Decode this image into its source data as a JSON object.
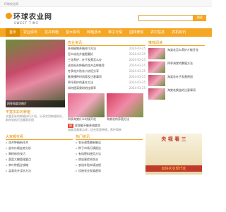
{
  "topbar": {
    "text": "环球农业网"
  },
  "logo": {
    "cn": "环球农业网",
    "en": "SWEET TIME"
  },
  "search": {
    "placeholder": "",
    "button": "搜索"
  },
  "nav": [
    "首页",
    "农业资讯",
    "花卉种植",
    "苗木资讯",
    "种植技术",
    "种子行情",
    "园林景观",
    "农村信息",
    "农机资讯"
  ],
  "hero": {
    "caption": "四季海棠花图片"
  },
  "featured": {
    "title": "丰富多彩的种植",
    "desc": "丰富多彩的种植技巧介绍，分享实用种植知识，助你轻松打造美丽花园"
  },
  "news": {
    "heading": "农业资讯",
    "items": [
      {
        "t": "多肉植物养殖技巧方法",
        "d": "2024-03-25"
      },
      {
        "t": "怎么给花卉施肥最好",
        "d": "2024-03-25"
      },
      {
        "t": "兰花养护：叶子发黄怎么办",
        "d": "2024-03-25"
      },
      {
        "t": "适合阳台种植的花卉品种推荐",
        "d": "2024-03-25"
      },
      {
        "t": "冬季花卉防冻小妙招分享",
        "d": "2024-03-25"
      },
      {
        "t": "春季播种时间表及注意事项",
        "d": "2024-03-25"
      },
      {
        "t": "草坪养护的基本方法",
        "d": "2024-03-25"
      },
      {
        "t": "如何提高果树的挂果率",
        "d": "2024-03-25"
      }
    ]
  },
  "thumbs": [
    {
      "cap": "四季海棠什么时候开花"
    },
    {
      "cap": "海棠花的养殖方法"
    }
  ],
  "hot": {
    "tag": "热",
    "title": "家里能不能养海棠花",
    "desc": "海棠花寓意吉祥，适合家庭种植，养护简单"
  },
  "recommend": {
    "heading": "推荐阅读",
    "items": [
      {
        "t": "海棠花怎么养护才能开花"
      },
      {
        "t": "四季海棠的繁殖方法"
      },
      {
        "t": "海棠花叶子发黄原因"
      },
      {
        "t": "海棠花换盆的注意事项"
      }
    ]
  },
  "left_list": {
    "heading": "大家都在看",
    "items": [
      "花卉种植新技术",
      "苗木价格走势分析",
      "果树修剪技巧",
      "蔬菜大棚管理要点",
      "茶叶种植全攻略",
      "盆栽花卉浇水方法",
      "中药材种植前景",
      "农资购买指南"
    ]
  },
  "mid_list": {
    "heading": "热门资讯",
    "items": [
      "农业政策最新解读",
      "种子市场行情报告",
      "有机肥料使用方法",
      "病虫害综合防治",
      "农机补贴申请流程",
      "设施农业发展趋势",
      "乡村振兴典型案例",
      "智慧农业应用"
    ]
  },
  "ad": {
    "title": "央 视 看 三",
    "band": "加快农业现代化"
  }
}
